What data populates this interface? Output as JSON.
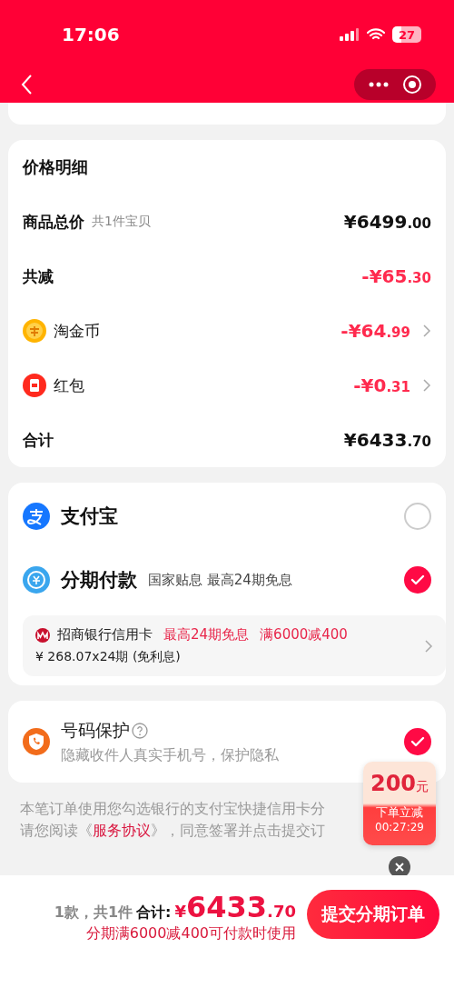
{
  "status_bar": {
    "time": "17:06",
    "battery": "27"
  },
  "price_card": {
    "title": "价格明细",
    "rows": [
      {
        "kind": "plain",
        "label": "商品总价",
        "note": "共1件宝贝",
        "amount": "¥6499",
        "decimals": ".00",
        "discount": false,
        "arrow": false
      },
      {
        "kind": "plain",
        "label": "共减",
        "amount": "-¥65",
        "decimals": ".30",
        "discount": true,
        "arrow": false
      },
      {
        "kind": "coin",
        "label": "淘金币",
        "amount": "-¥64",
        "decimals": ".99",
        "discount": true,
        "arrow": true
      },
      {
        "kind": "redpacket",
        "label": "红包",
        "amount": "-¥0",
        "decimals": ".31",
        "discount": true,
        "arrow": true
      },
      {
        "kind": "plain",
        "label": "合计",
        "amount": "¥6433",
        "decimals": ".70",
        "discount": false,
        "arrow": false
      }
    ]
  },
  "payment": {
    "methods": [
      {
        "kind": "alipay",
        "name": "支付宝",
        "selected": false
      },
      {
        "kind": "installment",
        "name": "分期付款",
        "note": "国家贴息 最高24期免息",
        "selected": true
      }
    ],
    "bank": {
      "name": "招商银行信用卡",
      "tags": [
        "最高24期免息",
        "满6000减400"
      ],
      "plan": "¥ 268.07x24期 (免利息)"
    }
  },
  "protection": {
    "title": "号码保护",
    "desc": "隐藏收件人真实手机号，保护隐私",
    "checked": true
  },
  "notice": {
    "line1": "本笔订单使用您勾选银行的支付宝快捷信用卡分",
    "line2_before": "请您阅读《",
    "link": "服务协议",
    "line2_after": "》，同意签署并点击提交订"
  },
  "coupon": {
    "amount": "200",
    "unit": "元",
    "label": "下单立减",
    "timer": "00:27:29"
  },
  "bottom_bar": {
    "count": "1款，共1件",
    "total_label": "合计:",
    "currency": "¥",
    "total": "6433",
    "decimals": ".70",
    "promo": "分期满6000减400可付款时使用",
    "submit": "提交分期订单"
  }
}
